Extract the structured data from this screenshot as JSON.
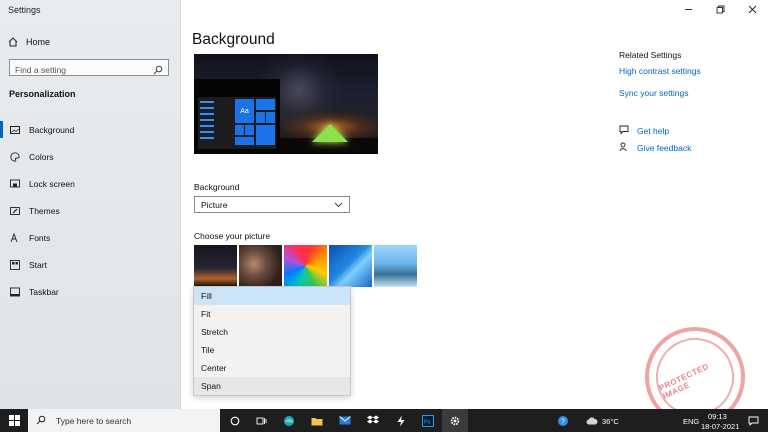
{
  "app": {
    "title": "Settings"
  },
  "sidebar": {
    "home_label": "Home",
    "search_placeholder": "Find a setting",
    "section_title": "Personalization",
    "items": [
      {
        "label": "Background",
        "icon": "image-icon",
        "active": true
      },
      {
        "label": "Colors",
        "icon": "palette-icon"
      },
      {
        "label": "Lock screen",
        "icon": "lock-screen-icon"
      },
      {
        "label": "Themes",
        "icon": "brush-icon"
      },
      {
        "label": "Fonts",
        "icon": "font-icon"
      },
      {
        "label": "Start",
        "icon": "start-icon"
      },
      {
        "label": "Taskbar",
        "icon": "taskbar-icon"
      }
    ]
  },
  "main": {
    "title": "Background",
    "preview_tile_label": "Aa",
    "background_label": "Background",
    "background_value": "Picture",
    "choose_picture_label": "Choose your picture",
    "fit_options": [
      "Fill",
      "Fit",
      "Stretch",
      "Tile",
      "Center",
      "Span"
    ],
    "fit_highlighted": "Fill"
  },
  "related": {
    "title": "Related Settings",
    "links": [
      "High contrast settings",
      "Sync your settings"
    ],
    "get_help": "Get help",
    "give_feedback": "Give feedback"
  },
  "stamp": {
    "text": "PROTECTED IMAGE"
  },
  "taskbar": {
    "search_placeholder": "Type here to search",
    "temperature": "36°C",
    "language": "ENG",
    "time": "09:13",
    "date": "18-07-2021"
  },
  "colors": {
    "accent": "#0067c0",
    "highlight": "#cce4f7",
    "taskbar": "#1e1e1e"
  }
}
